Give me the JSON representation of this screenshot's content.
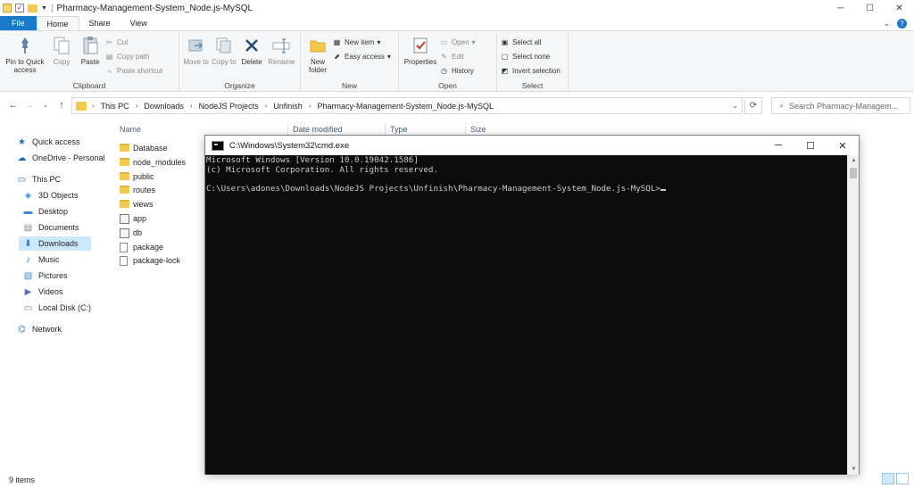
{
  "window": {
    "title": "Pharmacy-Management-System_Node.js-MySQL",
    "controls": [
      "─",
      "☐",
      "✕"
    ]
  },
  "tabs": [
    {
      "label": "File"
    },
    {
      "label": "Home"
    },
    {
      "label": "Share"
    },
    {
      "label": "View"
    }
  ],
  "ribbon": {
    "clipboard": {
      "label": "Clipboard",
      "pin": "Pin to Quick access",
      "copy": "Copy",
      "paste": "Paste",
      "cut": "Cut",
      "copy_path": "Copy path",
      "paste_shortcut": "Paste shortcut"
    },
    "organize": {
      "label": "Organize",
      "move_to": "Move to",
      "copy_to": "Copy to",
      "delete": "Delete",
      "rename": "Rename"
    },
    "new": {
      "label": "New",
      "new_folder": "New folder",
      "new_item": "New item",
      "easy_access": "Easy access"
    },
    "open": {
      "label": "Open",
      "properties": "Properties",
      "open": "Open",
      "edit": "Edit",
      "history": "History"
    },
    "select": {
      "label": "Select",
      "select_all": "Select all",
      "select_none": "Select none",
      "invert": "Invert selection"
    }
  },
  "address": {
    "crumbs": [
      "This PC",
      "Downloads",
      "NodeJS Projects",
      "Unfinish",
      "Pharmacy-Management-System_Node.js-MySQL"
    ],
    "search_placeholder": "Search Pharmacy-Managem..."
  },
  "nav": {
    "items": [
      {
        "label": "Quick access",
        "icon": "star-icon"
      },
      {
        "label": "OneDrive - Personal",
        "icon": "cloud-icon"
      },
      {
        "label": "This PC",
        "icon": "computer-icon"
      },
      {
        "label": "3D Objects",
        "icon": "cube-icon"
      },
      {
        "label": "Desktop",
        "icon": "desktop-icon"
      },
      {
        "label": "Documents",
        "icon": "documents-icon"
      },
      {
        "label": "Downloads",
        "icon": "download-icon"
      },
      {
        "label": "Music",
        "icon": "music-icon"
      },
      {
        "label": "Pictures",
        "icon": "pictures-icon"
      },
      {
        "label": "Videos",
        "icon": "videos-icon"
      },
      {
        "label": "Local Disk (C:)",
        "icon": "disk-icon"
      },
      {
        "label": "Network",
        "icon": "network-icon"
      }
    ]
  },
  "columns": [
    "Name",
    "Date modified",
    "Type",
    "Size"
  ],
  "files": [
    {
      "name": "Database",
      "kind": "folder"
    },
    {
      "name": "node_modules",
      "kind": "folder"
    },
    {
      "name": "public",
      "kind": "folder"
    },
    {
      "name": "routes",
      "kind": "folder"
    },
    {
      "name": "views",
      "kind": "folder"
    },
    {
      "name": "app",
      "kind": "js"
    },
    {
      "name": "db",
      "kind": "js"
    },
    {
      "name": "package",
      "kind": "json"
    },
    {
      "name": "package-lock",
      "kind": "json"
    }
  ],
  "status": {
    "items": "9 items"
  },
  "cmd": {
    "title": "C:\\Windows\\System32\\cmd.exe",
    "lines": [
      "Microsoft Windows [Version 10.0.19042.1586]",
      "(c) Microsoft Corporation. All rights reserved.",
      "",
      "C:\\Users\\adones\\Downloads\\NodeJS Projects\\Unfinish\\Pharmacy-Management-System_Node.js-MySQL>"
    ]
  }
}
